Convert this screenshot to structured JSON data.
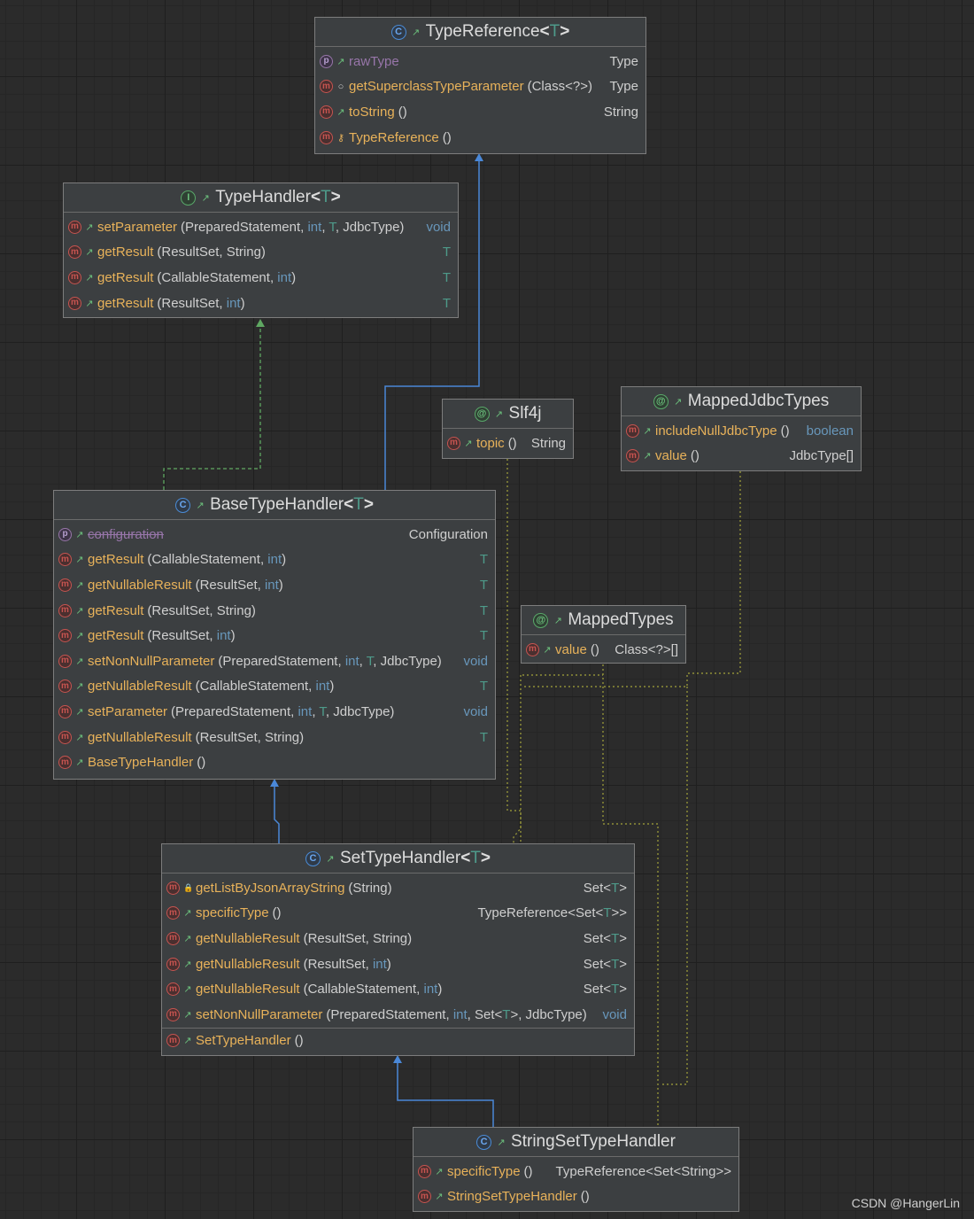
{
  "nodes": {
    "typeReference": {
      "kind": "C",
      "title": "TypeReference",
      "generic": "T",
      "rows": [
        {
          "icon": "p",
          "vis": "↗",
          "name": "rawType",
          "ret": "Type"
        },
        {
          "icon": "m",
          "vis": "○",
          "name": "getSuperclassTypeParameter",
          "args": "(Class<?>)",
          "ret": "Type"
        },
        {
          "icon": "m",
          "vis": "↗",
          "name": "toString",
          "args": "()",
          "ret": "String"
        },
        {
          "icon": "m",
          "vis": "⚲",
          "name": "TypeReference",
          "args": "()",
          "ret": ""
        }
      ]
    },
    "typeHandler": {
      "kind": "I",
      "title": "TypeHandler",
      "generic": "T",
      "rows": [
        {
          "icon": "m",
          "vis": "↗",
          "name": "setParameter",
          "args": "(PreparedStatement, int, T, JdbcType)",
          "ret": "void"
        },
        {
          "icon": "m",
          "vis": "↗",
          "name": "getResult",
          "args": "(ResultSet, String)",
          "ret": "T"
        },
        {
          "icon": "m",
          "vis": "↗",
          "name": "getResult",
          "args": "(CallableStatement, int)",
          "ret": "T"
        },
        {
          "icon": "m",
          "vis": "↗",
          "name": "getResult",
          "args": "(ResultSet, int)",
          "ret": "T"
        }
      ]
    },
    "slf4j": {
      "kind": "@",
      "title": "Slf4j",
      "rows": [
        {
          "icon": "m",
          "vis": "↗",
          "name": "topic",
          "args": "()",
          "ret": "String"
        }
      ]
    },
    "mappedJdbcTypes": {
      "kind": "@",
      "title": "MappedJdbcTypes",
      "rows": [
        {
          "icon": "m",
          "vis": "↗",
          "name": "includeNullJdbcType",
          "args": "()",
          "ret": "boolean"
        },
        {
          "icon": "m",
          "vis": "↗",
          "name": "value",
          "args": "()",
          "ret": "JdbcType[]"
        }
      ]
    },
    "baseTypeHandler": {
      "kind": "C",
      "title": "BaseTypeHandler",
      "generic": "T",
      "rows": [
        {
          "icon": "p",
          "vis": "↗",
          "name": "configuration",
          "ret": "Configuration"
        },
        {
          "icon": "m",
          "vis": "↗",
          "name": "getResult",
          "args": "(CallableStatement, int)",
          "ret": "T"
        },
        {
          "icon": "m",
          "vis": "↗",
          "name": "getNullableResult",
          "args": "(ResultSet, int)",
          "ret": "T"
        },
        {
          "icon": "m",
          "vis": "↗",
          "name": "getResult",
          "args": "(ResultSet, String)",
          "ret": "T"
        },
        {
          "icon": "m",
          "vis": "↗",
          "name": "getResult",
          "args": "(ResultSet, int)",
          "ret": "T"
        },
        {
          "icon": "m",
          "vis": "↗",
          "name": "setNonNullParameter",
          "args": "(PreparedStatement, int, T, JdbcType)",
          "ret": "void"
        },
        {
          "icon": "m",
          "vis": "↗",
          "name": "getNullableResult",
          "args": "(CallableStatement, int)",
          "ret": "T"
        },
        {
          "icon": "m",
          "vis": "↗",
          "name": "setParameter",
          "args": "(PreparedStatement, int, T, JdbcType)",
          "ret": "void"
        },
        {
          "icon": "m",
          "vis": "↗",
          "name": "getNullableResult",
          "args": "(ResultSet, String)",
          "ret": "T"
        },
        {
          "icon": "m",
          "vis": "↗",
          "name": "BaseTypeHandler",
          "args": "()",
          "ret": ""
        }
      ]
    },
    "mappedTypes": {
      "kind": "@",
      "title": "MappedTypes",
      "rows": [
        {
          "icon": "m",
          "vis": "↗",
          "name": "value",
          "args": "()",
          "ret": "Class<?>[]"
        }
      ]
    },
    "setTypeHandler": {
      "kind": "C",
      "title": "SetTypeHandler",
      "generic": "T",
      "rows": [
        {
          "icon": "m",
          "vis": "🔒",
          "name": "getListByJsonArrayString",
          "args": "(String)",
          "ret": "Set<T>"
        },
        {
          "icon": "m",
          "vis": "↗",
          "name": "specificType",
          "args": "()",
          "ret": "TypeReference<Set<T>>"
        },
        {
          "icon": "m",
          "vis": "↗",
          "name": "getNullableResult",
          "args": "(ResultSet, String)",
          "ret": "Set<T>"
        },
        {
          "icon": "m",
          "vis": "↗",
          "name": "getNullableResult",
          "args": "(ResultSet, int)",
          "ret": "Set<T>"
        },
        {
          "icon": "m",
          "vis": "↗",
          "name": "getNullableResult",
          "args": "(CallableStatement, int)",
          "ret": "Set<T>"
        },
        {
          "icon": "m",
          "vis": "↗",
          "name": "setNonNullParameter",
          "args": "(PreparedStatement, int, Set<T>, JdbcType)",
          "ret": "void"
        },
        {
          "icon": "m",
          "vis": "↗",
          "name": "SetTypeHandler",
          "args": "()",
          "ret": ""
        }
      ]
    },
    "stringSetTypeHandler": {
      "kind": "C",
      "title": "StringSetTypeHandler",
      "rows": [
        {
          "icon": "m",
          "vis": "↗",
          "name": "specificType",
          "args": "()",
          "ret": "TypeReference<Set<String>>"
        },
        {
          "icon": "m",
          "vis": "↗",
          "name": "StringSetTypeHandler",
          "args": "()",
          "ret": ""
        }
      ]
    }
  },
  "watermark": "CSDN @HangerLin",
  "colors": {
    "inheritance": "#4a88d8",
    "implements": "#5fa862",
    "annotation": "#a3a33a"
  }
}
